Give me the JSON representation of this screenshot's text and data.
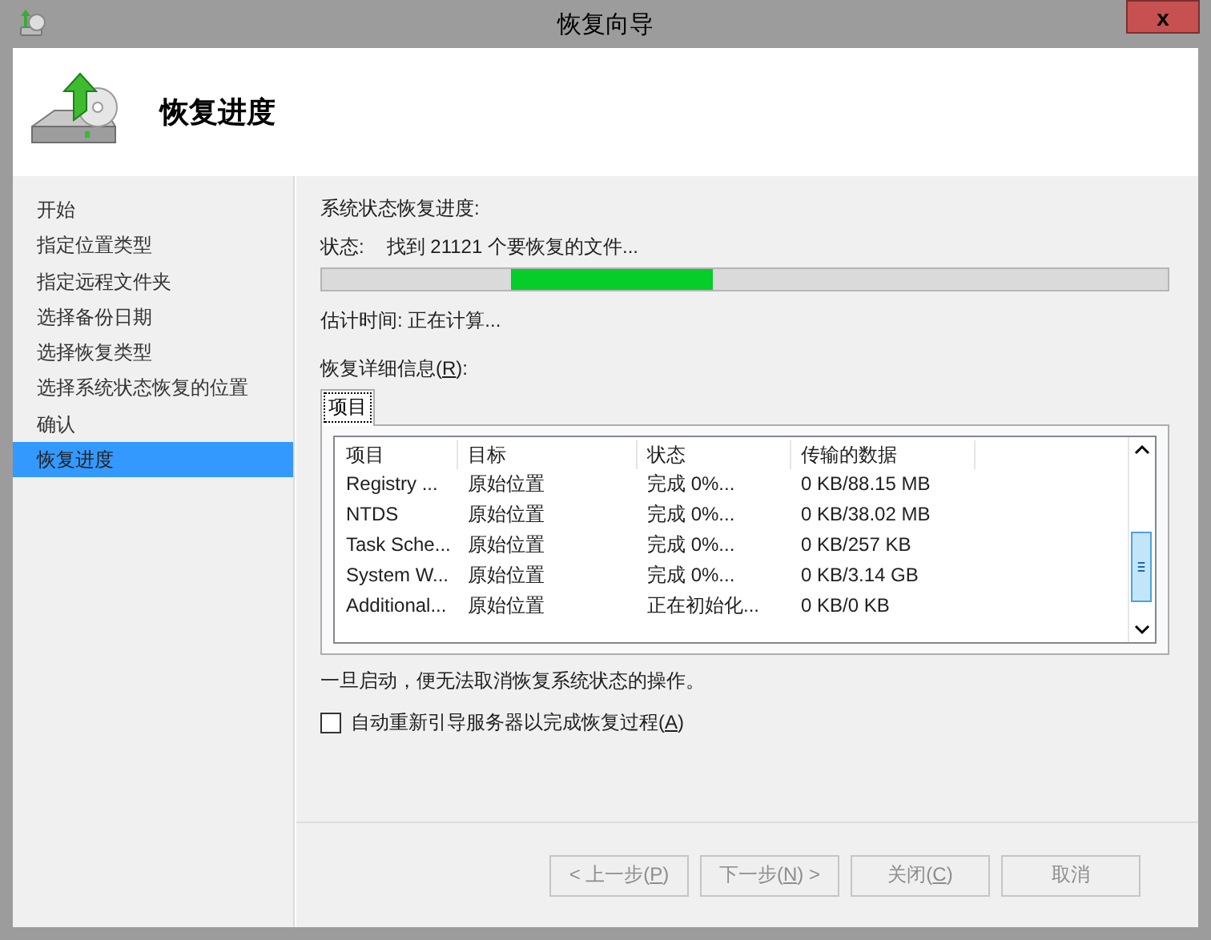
{
  "window": {
    "title": "恢复向导",
    "close_symbol": "x"
  },
  "header": {
    "title": "恢复进度"
  },
  "sidebar": {
    "items": [
      {
        "label": "开始",
        "selected": false
      },
      {
        "label": "指定位置类型",
        "selected": false
      },
      {
        "label": "指定远程文件夹",
        "selected": false
      },
      {
        "label": "选择备份日期",
        "selected": false
      },
      {
        "label": "选择恢复类型",
        "selected": false
      },
      {
        "label": "选择系统状态恢复的位置",
        "selected": false
      },
      {
        "label": "确认",
        "selected": false
      },
      {
        "label": "恢复进度",
        "selected": true
      }
    ]
  },
  "progress": {
    "level": 0.24,
    "heading": "系统状态恢复进度:",
    "status_label": "状态:",
    "status_value": "找到 21121 个要恢复的文件...",
    "estimate": "估计时间: 正在计算..."
  },
  "details": {
    "label": "恢复详细信息(**R**):",
    "tabs": [
      {
        "label": "项目",
        "selected": true
      }
    ],
    "table": {
      "columns": [
        "项目",
        "目标",
        "状态",
        "传输的数据"
      ],
      "rows": [
        [
          "Registry ...",
          "原始位置",
          "完成 0%...",
          "0 KB/88.15 MB"
        ],
        [
          "NTDS",
          "原始位置",
          "完成 0%...",
          "0 KB/38.02 MB"
        ],
        [
          "Task Sche...",
          "原始位置",
          "完成 0%...",
          "0 KB/257 KB"
        ],
        [
          "System W...",
          "原始位置",
          "完成 0%...",
          "0 KB/3.14 GB"
        ],
        [
          "Additional...",
          "原始位置",
          "正在初始化...",
          "0 KB/0 KB"
        ]
      ]
    }
  },
  "note": "一旦启动，便无法取消恢复系统状态的操作。",
  "restart_option": {
    "label": "自动重新引导服务器以完成恢复过程(**A**)",
    "checked": false
  },
  "buttons": [
    {
      "label": "< 上一步(**P**)",
      "disabled": true
    },
    {
      "label": "下一步(**N**) >",
      "disabled": true
    },
    {
      "label": "关闭(**C**)",
      "disabled": true
    },
    {
      "label": "取消",
      "disabled": true
    }
  ]
}
